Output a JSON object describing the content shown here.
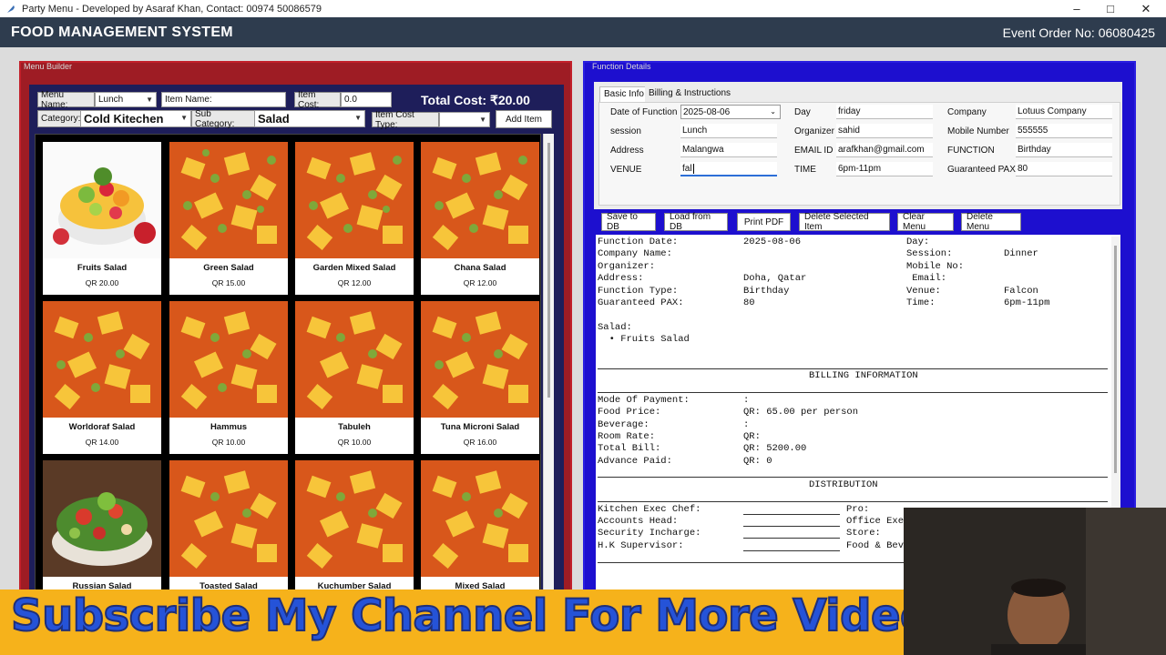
{
  "window": {
    "title": "Party Menu - Developed by Asaraf Khan, Contact: 00974 50086579",
    "minimize": "–",
    "maximize": "□",
    "close": "✕"
  },
  "header": {
    "app_title": "FOOD MANAGEMENT SYSTEM",
    "event_order": "Event Order No: 06080425"
  },
  "menu_builder": {
    "legend": "Menu Builder",
    "menu_name_label": "Menu Name:",
    "menu_name_value": "Lunch",
    "item_name_label": "Item Name:",
    "item_name_value": "",
    "item_cost_label": "Item Cost:",
    "item_cost_value": "0.0",
    "total_cost": "Total Cost: ₹20.00",
    "category_label": "Category:",
    "category_value": "Cold Kitechen",
    "sub_category_label": "Sub Category:",
    "sub_category_value": "Salad",
    "item_cost_type_label": "Item Cost Type:",
    "item_cost_type_value": "",
    "add_item": "Add Item",
    "items": [
      {
        "name": "Fruits Salad",
        "price": "QR 20.00",
        "image": "fruit-bowl"
      },
      {
        "name": "Green Salad",
        "price": "QR 15.00",
        "image": "curry-dish"
      },
      {
        "name": "Garden Mixed Salad",
        "price": "QR 12.00",
        "image": "curry-dish"
      },
      {
        "name": "Chana Salad",
        "price": "QR 12.00",
        "image": "curry-dish"
      },
      {
        "name": "Worldoraf Salad",
        "price": "QR 14.00",
        "image": "curry-dish"
      },
      {
        "name": "Hammus",
        "price": "QR 10.00",
        "image": "curry-dish"
      },
      {
        "name": "Tabuleh",
        "price": "QR 10.00",
        "image": "curry-dish"
      },
      {
        "name": "Tuna Microni Salad",
        "price": "QR 16.00",
        "image": "curry-dish"
      },
      {
        "name": "Russian Salad",
        "price": "",
        "image": "green-salad"
      },
      {
        "name": "Toasted Salad",
        "price": "",
        "image": "curry-dish"
      },
      {
        "name": "Kuchumber Salad",
        "price": "",
        "image": "curry-dish"
      },
      {
        "name": "Mixed Salad",
        "price": "",
        "image": "curry-dish"
      }
    ]
  },
  "function_details": {
    "legend": "Function Details",
    "tabs": [
      "Basic Info",
      "Billing & Instructions"
    ],
    "fields": {
      "date_label": "Date of Function",
      "date_value": "2025-08-06",
      "day_label": "Day",
      "day_value": "friday",
      "company_label": "Company",
      "company_value": "Lotuus Company",
      "session_label": "session",
      "session_value": "Lunch",
      "organizer_label": "Organizer",
      "organizer_value": "sahid",
      "mobile_label": "Mobile Number",
      "mobile_value": "555555",
      "address_label": "Address",
      "address_value": "Malangwa",
      "email_label": "EMAIL ID",
      "email_value": "arafkhan@gmail.com",
      "function_label": "FUNCTION",
      "function_value": "Birthday",
      "venue_label": "VENUE",
      "venue_value": "fal",
      "time_label": "TIME",
      "time_value": "6pm-11pm",
      "pax_label": "Guaranteed PAX",
      "pax_value": "80"
    },
    "buttons": [
      "Save to DB",
      "Load from DB",
      "Print PDF",
      "Delete Selected Item",
      "Clear Menu",
      "Delete Menu"
    ],
    "preview": {
      "l1a": "Function Date:",
      "l1b": "2025-08-06",
      "l1c": "Day:",
      "l2a": "Company Name:",
      "l2c": "Session:",
      "l2d": "Dinner",
      "l3a": "Organizer:",
      "l3c": "Mobile No:",
      "l4a": "Address:",
      "l4b": "Doha, Qatar",
      "l4c": " Email:",
      "l5a": "Function Type:",
      "l5b": "Birthday",
      "l5c": "Venue:",
      "l5d": "Falcon",
      "l6a": "Guaranteed PAX:",
      "l6b": "80",
      "l6c": "Time:",
      "l6d": "6pm-11pm",
      "section_label": "Salad:",
      "section_item": "  • Fruits Salad",
      "billing_heading": "BILLING INFORMATION",
      "b1a": "Mode Of Payment:",
      "b1b": ":",
      "b2a": "Food Price:",
      "b2b": "QR: 65.00 per person",
      "b3a": "Beverage:",
      "b3b": ":",
      "b4a": "Room Rate:",
      "b4b": "QR:",
      "b5a": "Total Bill:",
      "b5b": "QR: 5200.00",
      "b6a": "Advance Paid:",
      "b6b": "QR: 0",
      "distribution_heading": "DISTRIBUTION",
      "d1a": "Kitchen Exec Chef:",
      "d1c": "Pro:",
      "d2a": "Accounts Head:",
      "d2c": "Office Exe",
      "d3a": "Security Incharge:",
      "d3c": "Store:",
      "d4a": "H.K Supervisor:",
      "d4c": "Food & Bev"
    }
  },
  "overlay": {
    "banner": "Subscribe My Channel For More Video"
  }
}
